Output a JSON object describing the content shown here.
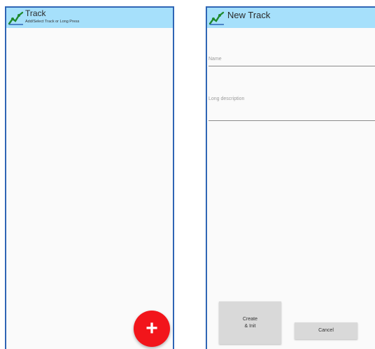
{
  "track_list_screen": {
    "title": "Track",
    "subtitle": "Add/Select Track or Long Press",
    "app_icon": "chart-line-icon",
    "fab_label": "+",
    "fab_icon": "add-icon",
    "fab_color": "#f2151b"
  },
  "new_track_screen": {
    "title": "New Track",
    "app_icon": "chart-line-icon",
    "name_placeholder": "Name",
    "description_placeholder": "Long description",
    "create_label": "Create\n& Init",
    "cancel_label": "Cancel"
  },
  "colors": {
    "appbar": "#a6e0fb",
    "frame_border": "#2f65b5",
    "button_bg": "#d9d9d9"
  }
}
